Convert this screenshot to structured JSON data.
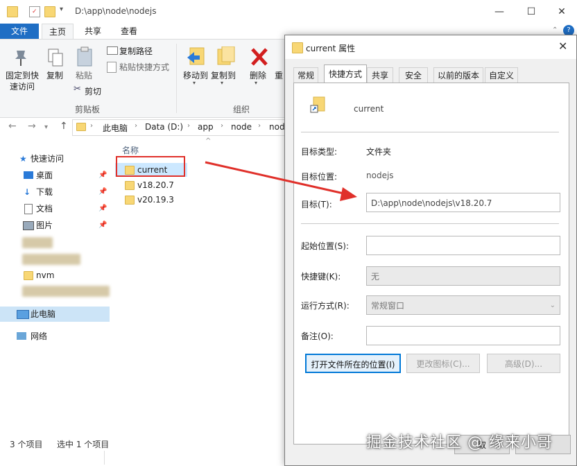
{
  "window": {
    "path_title": "D:\\app\\node\\nodejs",
    "controls": {
      "minimize": "—",
      "maximize": "☐",
      "close": "✕"
    }
  },
  "ribbon": {
    "tabs": [
      "文件",
      "主页",
      "共享",
      "查看"
    ],
    "clipboard": {
      "pin_label_1": "固定到快",
      "pin_label_2": "速访问",
      "copy": "复制",
      "paste": "粘贴",
      "copy_path": "复制路径",
      "paste_shortcut": "粘贴快捷方式",
      "cut": "剪切",
      "group_label": "剪贴板"
    },
    "organize": {
      "move_to": "移动到",
      "copy_to": "复制到",
      "delete": "删除",
      "rename": "重",
      "group_label": "组织"
    }
  },
  "address": {
    "crumbs": [
      "此电脑",
      "Data (D:)",
      "app",
      "node",
      "nod"
    ]
  },
  "nav": {
    "quick_access": "快速访问",
    "desktop": "桌面",
    "downloads": "下载",
    "documents": "文档",
    "pictures": "图片",
    "nvm": "nvm",
    "this_pc": "此电脑",
    "network": "网络"
  },
  "files": {
    "column_name": "名称",
    "items": [
      "current",
      "v18.20.7",
      "v20.19.3"
    ]
  },
  "status": {
    "count": "3 个项目",
    "selected": "选中 1 个项目"
  },
  "dialog": {
    "title": "current 属性",
    "tabs": [
      "常规",
      "快捷方式",
      "共享",
      "安全",
      "以前的版本",
      "自定义"
    ],
    "name": "current",
    "target_type_label": "目标类型:",
    "target_type_value": "文件夹",
    "target_location_label": "目标位置:",
    "target_location_value": "nodejs",
    "target_label": "目标(T):",
    "target_value": "D:\\app\\node\\nodejs\\v18.20.7",
    "start_in_label": "起始位置(S):",
    "start_in_value": "",
    "hotkey_label": "快捷键(K):",
    "hotkey_value": "无",
    "run_label": "运行方式(R):",
    "run_value": "常规窗口",
    "comment_label": "备注(O):",
    "comment_value": "",
    "btn_open_location": "打开文件所在的位置(I)",
    "btn_change_icon": "更改图标(C)...",
    "btn_advanced": "高级(D)...",
    "btn_cancel_partial": "取"
  },
  "watermark": "掘金技术社区 @ 缘来小哥",
  "colors": {
    "file_tab": "#1f6ec4",
    "annotation": "#e0302a",
    "primary_border": "#0078d7"
  }
}
